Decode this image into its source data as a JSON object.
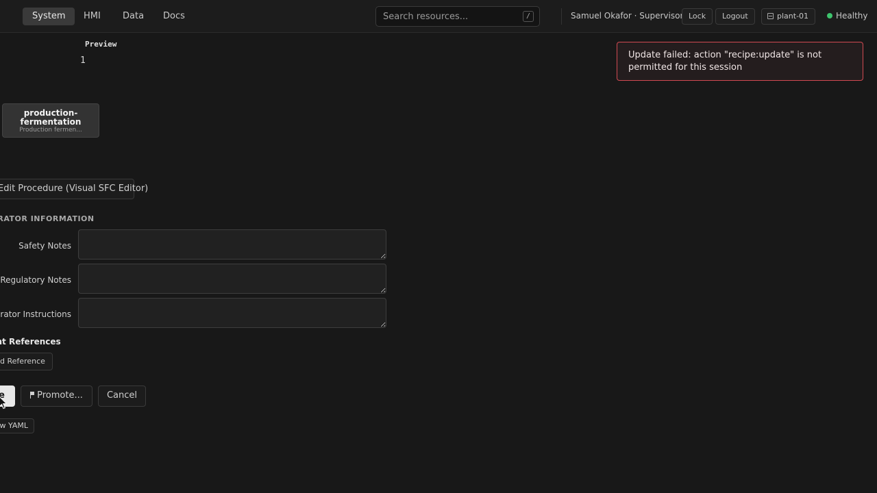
{
  "nav": {
    "tabs": [
      {
        "label": "System",
        "active": true
      },
      {
        "label": "HMI",
        "active": false
      },
      {
        "label": "Data",
        "active": false
      },
      {
        "label": "Docs",
        "active": false
      }
    ]
  },
  "search": {
    "placeholder": "Search resources...",
    "shortcut": "/"
  },
  "session": {
    "user": "Samuel Okafor · Supervisor",
    "lock_label": "Lock",
    "logout_label": "Logout",
    "plant_label": "plant-01",
    "health_label": "Healthy",
    "health_color": "#3ec46d"
  },
  "preview": {
    "label": "Preview",
    "value": "1"
  },
  "toast": {
    "message": "Update failed: action \"recipe:update\" is not permitted for this session",
    "border_color": "#d24a52"
  },
  "node": {
    "title": "production-fermentation",
    "subtitle": "Production fermen..."
  },
  "procedure_button": "Edit Procedure (Visual SFC Editor)",
  "operator_info": {
    "heading": "OPERATOR INFORMATION",
    "fields": [
      {
        "label": "Safety Notes",
        "value": ""
      },
      {
        "label": "Regulatory Notes",
        "value": ""
      },
      {
        "label": "Operator Instructions",
        "value": ""
      }
    ]
  },
  "document_refs": {
    "heading": "Document References",
    "add_label": "+ Add Reference"
  },
  "actions": {
    "save": "Save",
    "promote": "Promote...",
    "cancel": "Cancel",
    "view_yaml": "View YAML"
  }
}
